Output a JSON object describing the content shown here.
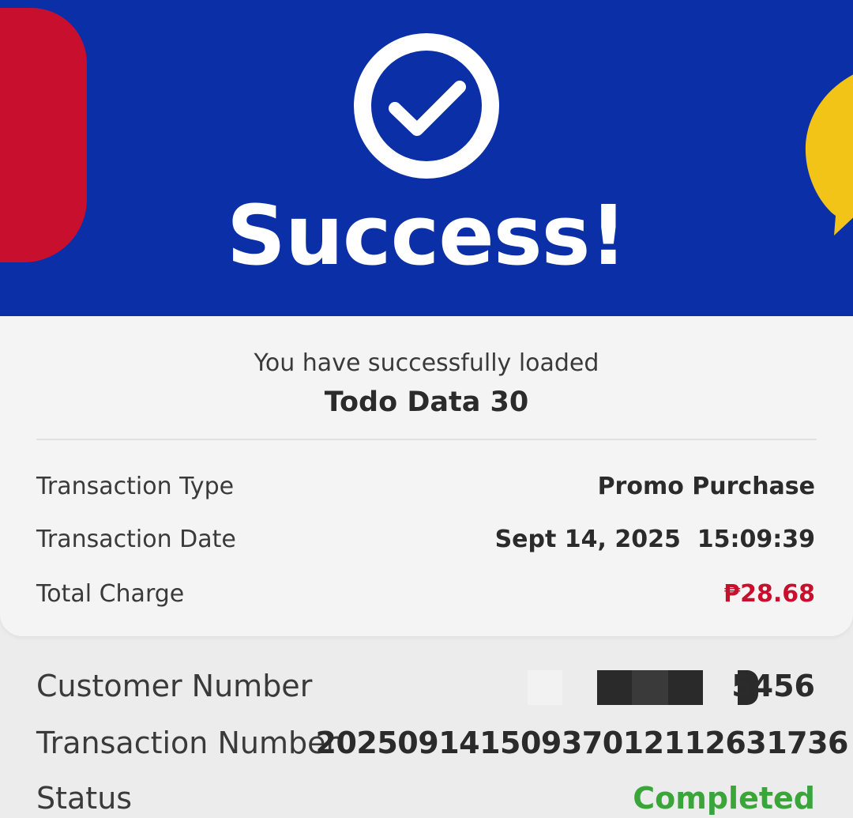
{
  "hero": {
    "title": "Success!",
    "colors": {
      "background": "#0b2fa6",
      "accent_red": "#c8102e",
      "accent_yellow": "#f2c417"
    },
    "icons": [
      "check-circle-icon",
      "chat-bubble-icon"
    ]
  },
  "receipt": {
    "intro": "You have successfully loaded",
    "product": "Todo Data 30",
    "rows": [
      {
        "label": "Transaction Type",
        "value": "Promo Purchase"
      },
      {
        "label": "Transaction Date",
        "value": "Sept 14, 2025  15:09:39"
      },
      {
        "label": "Total Charge",
        "value": "₱28.68"
      }
    ]
  },
  "details": {
    "customer_number": {
      "label": "Customer Number",
      "value": "5456"
    },
    "transaction_number": {
      "label": "Transaction Number",
      "value": "20250914150937012112631736"
    },
    "status": {
      "label": "Status",
      "value": "Completed"
    }
  }
}
